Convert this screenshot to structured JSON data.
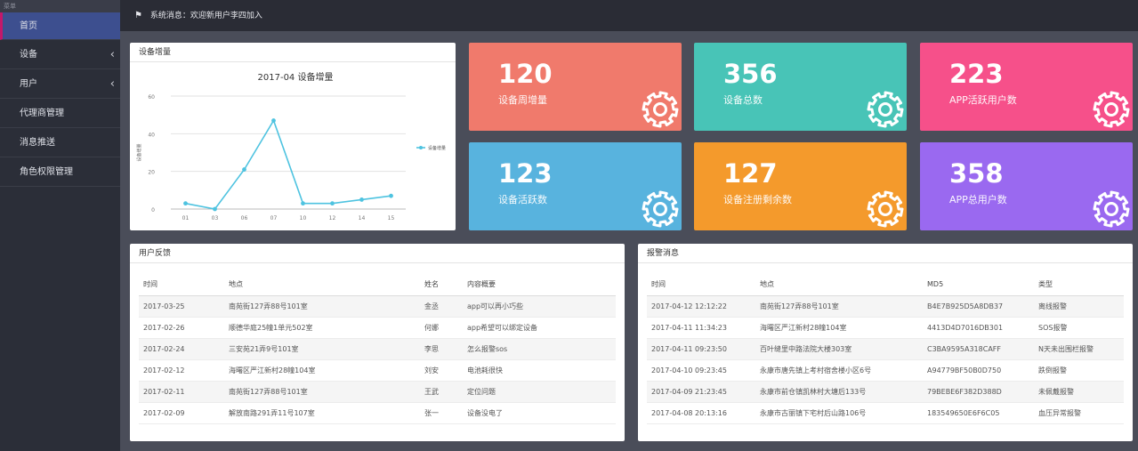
{
  "sidebar": {
    "header": "菜单",
    "items": [
      {
        "label": "首页",
        "active": true,
        "chevron": false
      },
      {
        "label": "设备",
        "active": false,
        "chevron": true
      },
      {
        "label": "用户",
        "active": false,
        "chevron": true
      },
      {
        "label": "代理商管理",
        "active": false,
        "chevron": false
      },
      {
        "label": "消息推送",
        "active": false,
        "chevron": false
      },
      {
        "label": "角色权限管理",
        "active": false,
        "chevron": false
      }
    ]
  },
  "topbar": {
    "icon": "flag-icon",
    "message": "系统消息：欢迎新用户李四加入"
  },
  "chart_panel": {
    "title": "设备增量"
  },
  "chart_data": {
    "type": "line",
    "title": "2017-04  设备增量",
    "categories": [
      "01",
      "03",
      "06",
      "07",
      "10",
      "12",
      "14",
      "15"
    ],
    "series": [
      {
        "name": "设备增量",
        "values": [
          3,
          0,
          21,
          47,
          3,
          3,
          5,
          7
        ]
      }
    ],
    "ylim": [
      0,
      60
    ],
    "yticks": [
      "0",
      "20",
      "40",
      "60"
    ],
    "ylabel": "设备增量",
    "grid": true,
    "legend": "right",
    "color": "#4ec3e0"
  },
  "stats": [
    {
      "value": "120",
      "label": "设备周增量",
      "color": "#f07a6c"
    },
    {
      "value": "356",
      "label": "设备总数",
      "color": "#48c4b7"
    },
    {
      "value": "223",
      "label": "APP活跃用户数",
      "color": "#f6508a"
    },
    {
      "value": "123",
      "label": "设备活跃数",
      "color": "#58b3de"
    },
    {
      "value": "127",
      "label": "设备注册剩余数",
      "color": "#f49a2c"
    },
    {
      "value": "358",
      "label": "APP总用户数",
      "color": "#9a69f0"
    }
  ],
  "feedback": {
    "title": "用户反馈",
    "headers": [
      "时间",
      "地点",
      "姓名",
      "内容概要"
    ],
    "rows": [
      [
        "2017-03-25",
        "南苑街127弄88号101室",
        "金丞",
        "app可以再小巧些"
      ],
      [
        "2017-02-26",
        "顺德华庭25幢1单元502室",
        "何娜",
        "app希望可以绑定设备"
      ],
      [
        "2017-02-24",
        "三安苑21弄9号101室",
        "李思",
        "怎么报警sos"
      ],
      [
        "2017-02-12",
        "海曙区严江新村28幢104室",
        "刘安",
        "电池耗很快"
      ],
      [
        "2017-02-11",
        "南苑街127弄88号101室",
        "王武",
        "定位问题"
      ],
      [
        "2017-02-09",
        "解放南路291弄11号107室",
        "张一",
        "设备没电了"
      ]
    ]
  },
  "alarms": {
    "title": "报警消息",
    "headers": [
      "时间",
      "地点",
      "MD5",
      "类型"
    ],
    "rows": [
      [
        "2017-04-12 12:12:22",
        "南苑街127弄88号101室",
        "B4E7B925D5A8DB37",
        "离线报警"
      ],
      [
        "2017-04-11 11:34:23",
        "海曙区严江新村28幢104室",
        "4413D4D7016DB301",
        "SOS报警"
      ],
      [
        "2017-04-11 09:23:50",
        "百叶缝里中路法院大楼303室",
        "C3BA9595A318CAFF",
        "N天未出围栏报警"
      ],
      [
        "2017-04-10 09:23:45",
        "永康市唐先镇上考村宿舍楼小区6号",
        "A94779BF50B0D750",
        "跌倒报警"
      ],
      [
        "2017-04-09 21:23:45",
        "永康市前仓镇凯林村大塘后133号",
        "79BEBE6F382D388D",
        "未佩戴报警"
      ],
      [
        "2017-04-08 20:13:16",
        "永康市古丽镇下宅村后山路106号",
        "183549650E6F6C05",
        "血压异常报警"
      ]
    ]
  }
}
